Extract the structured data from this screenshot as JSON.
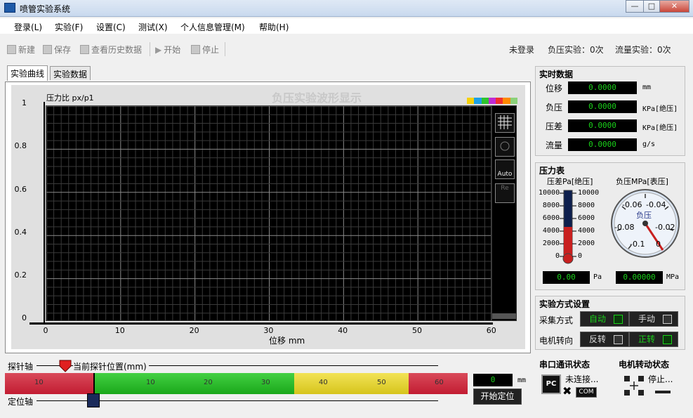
{
  "window": {
    "title": "喷管实验系统",
    "buttons": [
      "—",
      "□",
      "✕"
    ]
  },
  "menu": [
    "登录(L)",
    "实验(F)",
    "设置(C)",
    "测试(X)",
    "个人信息管理(M)",
    "帮助(H)"
  ],
  "toolbar": {
    "new": "新建",
    "save": "保存",
    "history": "查看历史数据",
    "start": "开始",
    "stop": "停止"
  },
  "status": {
    "login": "未登录",
    "neg": "负压实验：0次",
    "flow": "流量实验：0次"
  },
  "tabs": [
    "实验曲线",
    "实验数据"
  ],
  "chart_data": {
    "type": "line",
    "title": "负压实验波形显示",
    "ylabel": "压力比  px/p1",
    "xlabel": "位移  mm",
    "xlim": [
      0,
      60
    ],
    "ylim": [
      0,
      1
    ],
    "xticks": [
      "0",
      "10",
      "20",
      "30",
      "40",
      "50",
      "60"
    ],
    "yticks": [
      "0",
      "0.2",
      "0.4",
      "0.6",
      "0.8",
      "1"
    ],
    "series": [],
    "grid": true
  },
  "chart_side": {
    "auto": "Auto"
  },
  "realtime": {
    "title": "实时数据",
    "rows": [
      {
        "label": "位移",
        "value": "0.0000",
        "unit": "mm"
      },
      {
        "label": "负压",
        "value": "0.0000",
        "unit": "KPa[绝压]"
      },
      {
        "label": "压差",
        "value": "0.0000",
        "unit": "KPa[绝压]"
      },
      {
        "label": "流量",
        "value": "0.0000",
        "unit": "g/s"
      }
    ]
  },
  "gauges": {
    "title": "压力表",
    "therm_title": "压差Pa[绝压]",
    "therm_ticks": [
      "10000",
      "8000",
      "6000",
      "4000",
      "2000",
      "0"
    ],
    "therm_value": "0.00",
    "therm_unit": "Pa",
    "dial_title": "负压MPa[表压]",
    "dial_label": "负压",
    "dial_ticks": [
      "-0.06",
      "-0.04",
      "-0.08",
      "-0.02",
      "-0.1",
      "0"
    ],
    "dial_value": "0.00000",
    "dial_unit": "MPa"
  },
  "mode": {
    "title": "实验方式设置",
    "collect_label": "采集方式",
    "collect_auto": "自动",
    "collect_manual": "手动",
    "motor_label": "电机转向",
    "motor_rev": "反转",
    "motor_fwd": "正转"
  },
  "serial": {
    "title": "串口通讯状态",
    "pc": "PC",
    "status": "未连接...",
    "port": "COM"
  },
  "motor_state": {
    "title": "电机转动状态",
    "status": "停止..."
  },
  "probe": {
    "axis_label": "探针轴",
    "position_label": "当前探针位置(mm)",
    "locate_label": "定位轴",
    "ticks": [
      "10",
      "10",
      "20",
      "30",
      "40",
      "50",
      "60"
    ],
    "value": "0",
    "unit": "mm",
    "button": "开始定位"
  }
}
